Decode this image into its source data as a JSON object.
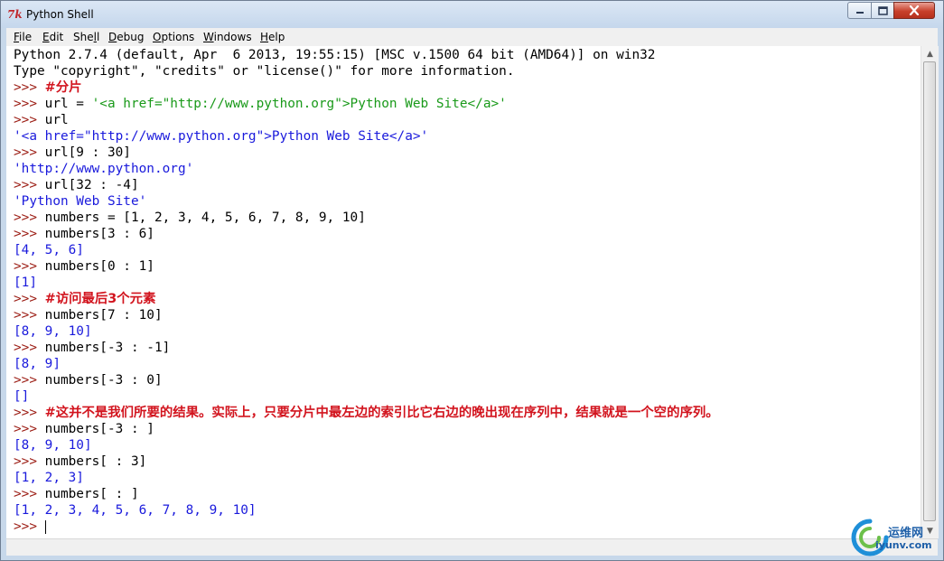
{
  "window": {
    "title": "Python Shell"
  },
  "menubar": {
    "items": [
      {
        "label_u": "F",
        "label_rest": "ile"
      },
      {
        "label_u": "E",
        "label_rest": "dit"
      },
      {
        "label_pre": "She",
        "label_u": "l",
        "label_rest": "l"
      },
      {
        "label_u": "D",
        "label_rest": "ebug"
      },
      {
        "label_u": "O",
        "label_rest": "ptions"
      },
      {
        "label_u": "W",
        "label_rest": "indows"
      },
      {
        "label_u": "H",
        "label_rest": "elp"
      }
    ]
  },
  "shell": {
    "lines": [
      [
        {
          "t": "info",
          "s": "Python 2.7.4 (default, Apr  6 2013, 19:55:15) [MSC v.1500 64 bit (AMD64)] on win32"
        }
      ],
      [
        {
          "t": "info",
          "s": "Type \"copyright\", \"credits\" or \"license()\" for more information."
        }
      ],
      [
        {
          "t": "prompt",
          "s": ">>> "
        },
        {
          "t": "comment",
          "s": "#分片"
        }
      ],
      [
        {
          "t": "prompt",
          "s": ">>> "
        },
        {
          "t": "code",
          "s": "url = "
        },
        {
          "t": "string",
          "s": "'<a href=\"http://www.python.org\">Python Web Site</a>'"
        }
      ],
      [
        {
          "t": "prompt",
          "s": ">>> "
        },
        {
          "t": "code",
          "s": "url"
        }
      ],
      [
        {
          "t": "out",
          "s": "'<a href=\"http://www.python.org\">Python Web Site</a>'"
        }
      ],
      [
        {
          "t": "prompt",
          "s": ">>> "
        },
        {
          "t": "code",
          "s": "url[9 : 30]"
        }
      ],
      [
        {
          "t": "out",
          "s": "'http://www.python.org'"
        }
      ],
      [
        {
          "t": "prompt",
          "s": ">>> "
        },
        {
          "t": "code",
          "s": "url[32 : -4]"
        }
      ],
      [
        {
          "t": "out",
          "s": "'Python Web Site'"
        }
      ],
      [
        {
          "t": "prompt",
          "s": ">>> "
        },
        {
          "t": "code",
          "s": "numbers = [1, 2, 3, 4, 5, 6, 7, 8, 9, 10]"
        }
      ],
      [
        {
          "t": "prompt",
          "s": ">>> "
        },
        {
          "t": "code",
          "s": "numbers[3 : 6]"
        }
      ],
      [
        {
          "t": "out",
          "s": "[4, 5, 6]"
        }
      ],
      [
        {
          "t": "prompt",
          "s": ">>> "
        },
        {
          "t": "code",
          "s": "numbers[0 : 1]"
        }
      ],
      [
        {
          "t": "out",
          "s": "[1]"
        }
      ],
      [
        {
          "t": "prompt",
          "s": ">>> "
        },
        {
          "t": "comment",
          "s": "#访问最后3个元素"
        }
      ],
      [
        {
          "t": "prompt",
          "s": ">>> "
        },
        {
          "t": "code",
          "s": "numbers[7 : 10]"
        }
      ],
      [
        {
          "t": "out",
          "s": "[8, 9, 10]"
        }
      ],
      [
        {
          "t": "prompt",
          "s": ">>> "
        },
        {
          "t": "code",
          "s": "numbers[-3 : -1]"
        }
      ],
      [
        {
          "t": "out",
          "s": "[8, 9]"
        }
      ],
      [
        {
          "t": "prompt",
          "s": ">>> "
        },
        {
          "t": "code",
          "s": "numbers[-3 : 0]"
        }
      ],
      [
        {
          "t": "out",
          "s": "[]"
        }
      ],
      [
        {
          "t": "prompt",
          "s": ">>> "
        },
        {
          "t": "comment",
          "s": "#这并不是我们所要的结果。实际上，只要分片中最左边的索引比它右边的晚出现在序列中，结果就是一个空的序列。"
        }
      ],
      [
        {
          "t": "prompt",
          "s": ">>> "
        },
        {
          "t": "code",
          "s": "numbers[-3 : ]"
        }
      ],
      [
        {
          "t": "out",
          "s": "[8, 9, 10]"
        }
      ],
      [
        {
          "t": "prompt",
          "s": ">>> "
        },
        {
          "t": "code",
          "s": "numbers[ : 3]"
        }
      ],
      [
        {
          "t": "out",
          "s": "[1, 2, 3]"
        }
      ],
      [
        {
          "t": "prompt",
          "s": ">>> "
        },
        {
          "t": "code",
          "s": "numbers[ : ]"
        }
      ],
      [
        {
          "t": "out",
          "s": "[1, 2, 3, 4, 5, 6, 7, 8, 9, 10]"
        }
      ],
      [
        {
          "t": "prompt",
          "s": ">>> "
        }
      ]
    ]
  },
  "watermark": {
    "line1": "运维网",
    "line2": "iyunv.com"
  },
  "colors": {
    "prompt": "#9b1b12",
    "comment": "#d2141e",
    "string": "#1a9a1a",
    "output": "#1a1adc"
  }
}
